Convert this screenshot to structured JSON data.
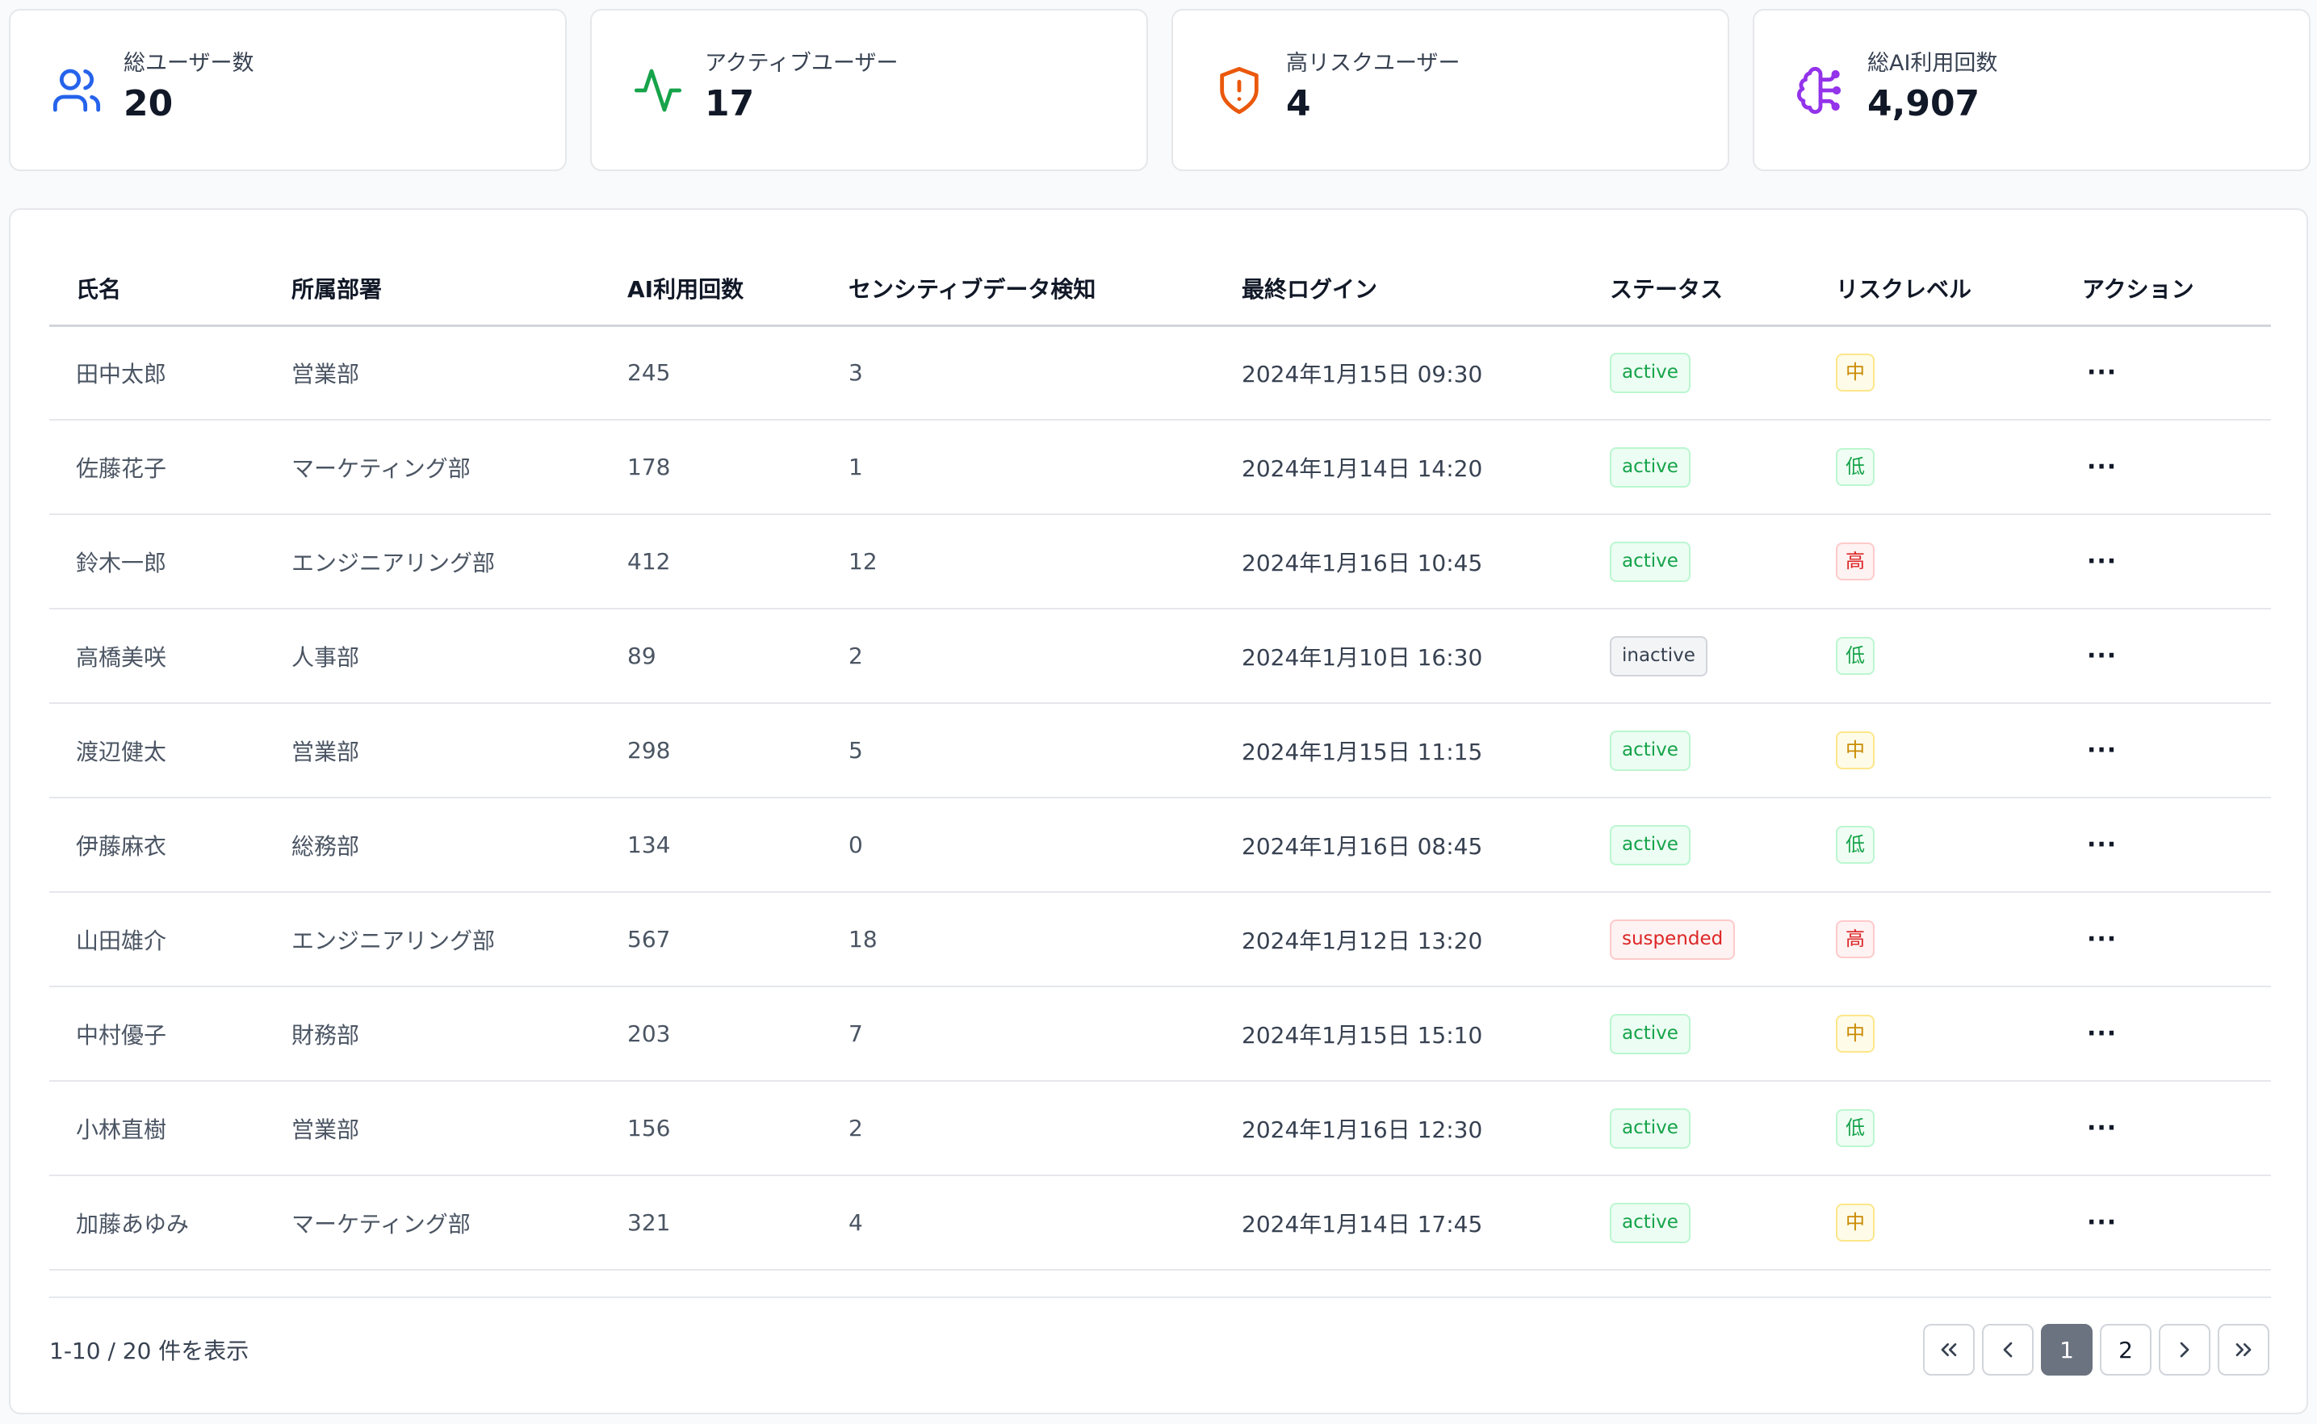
{
  "stats": [
    {
      "label": "総ユーザー数",
      "value": "20",
      "icon": "users-icon",
      "color": "#2563eb"
    },
    {
      "label": "アクティブユーザー",
      "value": "17",
      "icon": "activity-icon",
      "color": "#16a34a"
    },
    {
      "label": "高リスクユーザー",
      "value": "4",
      "icon": "shield-alert-icon",
      "color": "#ea580c"
    },
    {
      "label": "総AI利用回数",
      "value": "4,907",
      "icon": "brain-icon",
      "color": "#9333ea"
    }
  ],
  "table": {
    "headers": {
      "name": "氏名",
      "dept": "所属部署",
      "ai": "AI利用回数",
      "sensitive": "センシティブデータ検知",
      "login": "最終ログイン",
      "status": "ステータス",
      "risk": "リスクレベル",
      "action": "アクション"
    },
    "rows": [
      {
        "name": "田中太郎",
        "dept": "営業部",
        "ai": "245",
        "sensitive": "3",
        "login": "2024年1月15日 09:30",
        "status": "active",
        "risk": "中"
      },
      {
        "name": "佐藤花子",
        "dept": "マーケティング部",
        "ai": "178",
        "sensitive": "1",
        "login": "2024年1月14日 14:20",
        "status": "active",
        "risk": "低"
      },
      {
        "name": "鈴木一郎",
        "dept": "エンジニアリング部",
        "ai": "412",
        "sensitive": "12",
        "login": "2024年1月16日 10:45",
        "status": "active",
        "risk": "高"
      },
      {
        "name": "高橋美咲",
        "dept": "人事部",
        "ai": "89",
        "sensitive": "2",
        "login": "2024年1月10日 16:30",
        "status": "inactive",
        "risk": "低"
      },
      {
        "name": "渡辺健太",
        "dept": "営業部",
        "ai": "298",
        "sensitive": "5",
        "login": "2024年1月15日 11:15",
        "status": "active",
        "risk": "中"
      },
      {
        "name": "伊藤麻衣",
        "dept": "総務部",
        "ai": "134",
        "sensitive": "0",
        "login": "2024年1月16日 08:45",
        "status": "active",
        "risk": "低"
      },
      {
        "name": "山田雄介",
        "dept": "エンジニアリング部",
        "ai": "567",
        "sensitive": "18",
        "login": "2024年1月12日 13:20",
        "status": "suspended",
        "risk": "高"
      },
      {
        "name": "中村優子",
        "dept": "財務部",
        "ai": "203",
        "sensitive": "7",
        "login": "2024年1月15日 15:10",
        "status": "active",
        "risk": "中"
      },
      {
        "name": "小林直樹",
        "dept": "営業部",
        "ai": "156",
        "sensitive": "2",
        "login": "2024年1月16日 12:30",
        "status": "active",
        "risk": "低"
      },
      {
        "name": "加藤あゆみ",
        "dept": "マーケティング部",
        "ai": "321",
        "sensitive": "4",
        "login": "2024年1月14日 17:45",
        "status": "active",
        "risk": "中"
      }
    ],
    "action_label": "···"
  },
  "pagination": {
    "showing": "1-10 / 20 件を表示",
    "pages": [
      "1",
      "2"
    ],
    "current": "1"
  }
}
